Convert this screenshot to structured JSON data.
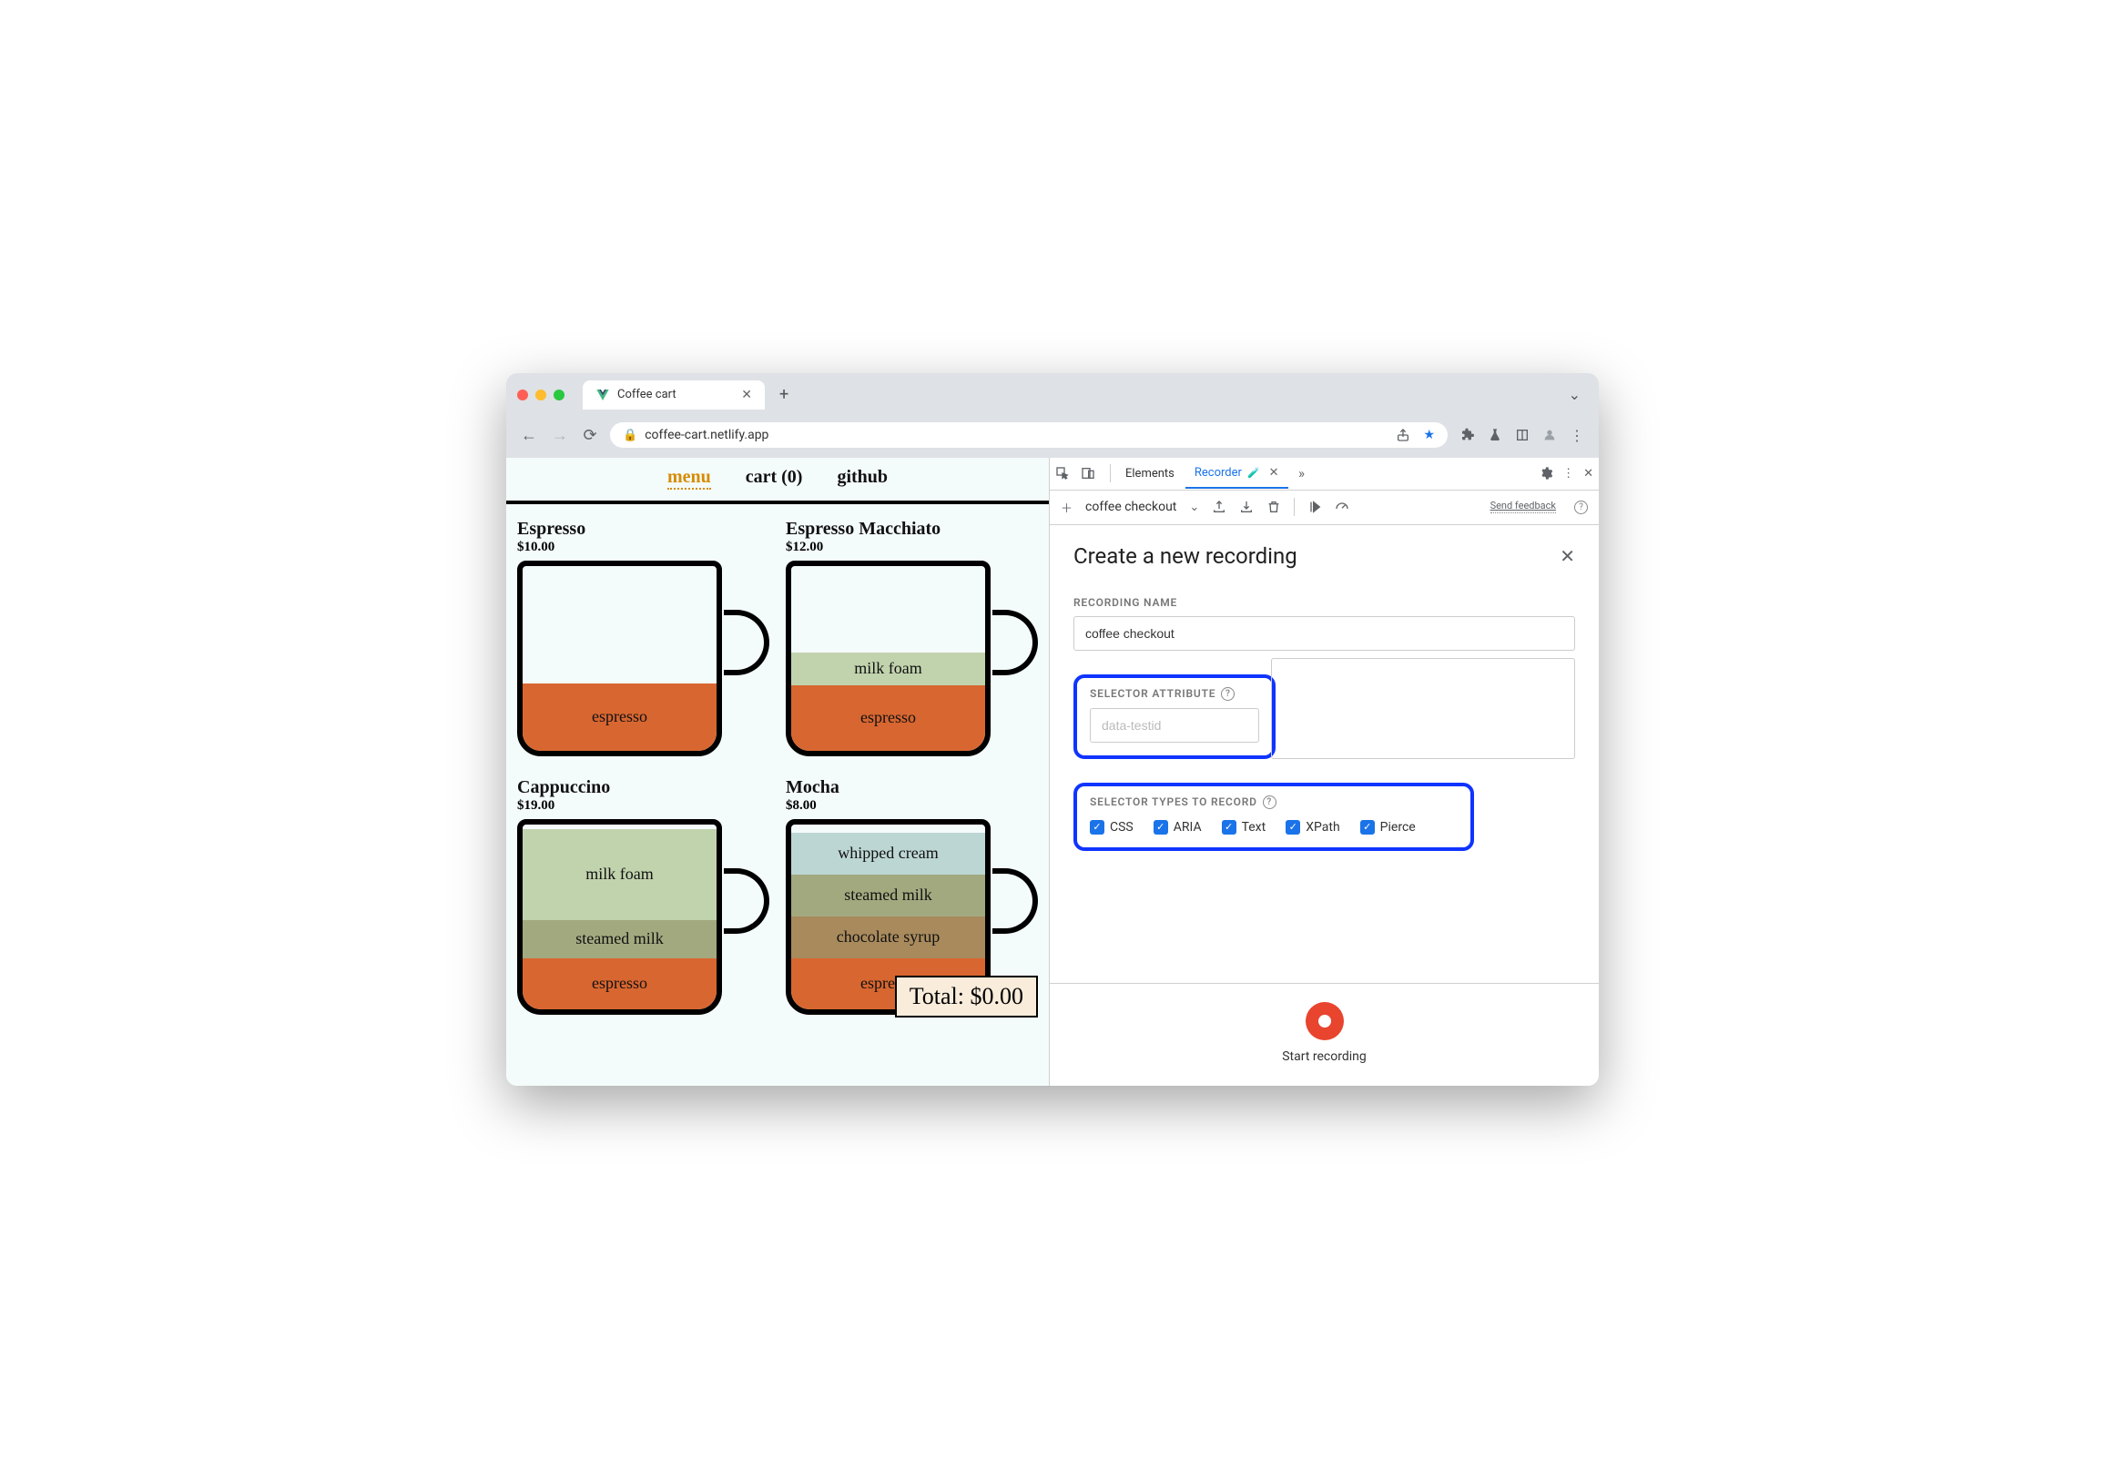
{
  "browser": {
    "tab_title": "Coffee cart",
    "url": "coffee-cart.netlify.app"
  },
  "page": {
    "nav": {
      "menu": "menu",
      "cart": "cart (0)",
      "github": "github"
    },
    "products": [
      {
        "name": "Espresso",
        "price": "$10.00",
        "layers": [
          {
            "cls": "espresso-l",
            "label": "espresso",
            "h": 74
          }
        ]
      },
      {
        "name": "Espresso Macchiato",
        "price": "$12.00",
        "layers": [
          {
            "cls": "milkfoam-l",
            "label": "milk foam",
            "h": 36
          },
          {
            "cls": "espresso-l",
            "label": "espresso",
            "h": 72
          }
        ]
      },
      {
        "name": "Cappuccino",
        "price": "$19.00",
        "layers": [
          {
            "cls": "milkfoam-l",
            "label": "milk foam",
            "h": 100
          },
          {
            "cls": "steamed-l",
            "label": "steamed milk",
            "h": 42
          },
          {
            "cls": "espresso-l",
            "label": "espresso",
            "h": 56
          }
        ]
      },
      {
        "name": "Mocha",
        "price": "$8.00",
        "layers": [
          {
            "cls": "whipped-l",
            "label": "whipped cream",
            "h": 46
          },
          {
            "cls": "steamed-l",
            "label": "steamed milk",
            "h": 46
          },
          {
            "cls": "choc-l",
            "label": "chocolate syrup",
            "h": 46
          },
          {
            "cls": "espresso-l",
            "label": "espresso",
            "h": 56
          }
        ]
      }
    ],
    "total_label": "Total: $0.00"
  },
  "devtools": {
    "tabs": {
      "elements": "Elements",
      "recorder": "Recorder"
    },
    "toolbar": {
      "recording_name": "coffee checkout",
      "feedback": "Send feedback"
    },
    "panel": {
      "title": "Create a new recording",
      "name_label": "RECORDING NAME",
      "name_value": "coffee checkout",
      "selector_attr_label": "SELECTOR ATTRIBUTE",
      "selector_attr_placeholder": "data-testid",
      "selector_types_label": "SELECTOR TYPES TO RECORD",
      "checks": [
        "CSS",
        "ARIA",
        "Text",
        "XPath",
        "Pierce"
      ]
    },
    "footer": {
      "start": "Start recording"
    }
  }
}
